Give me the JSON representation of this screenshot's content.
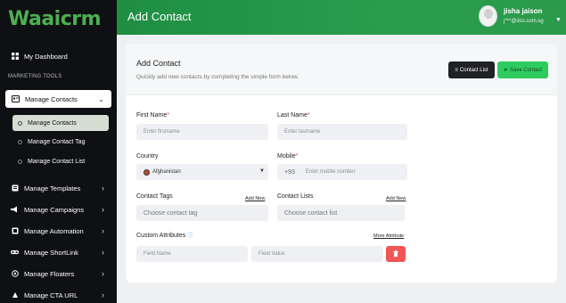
{
  "sidebar": {
    "logo": "Waaicrm",
    "dashboard": "My Dashboard",
    "section": "MARKETING TOOLS",
    "group": "Manage Contacts",
    "sub_items": [
      "Manage Contacts",
      "Manage Contact Tag",
      "Manage Contact List"
    ],
    "items": [
      {
        "label": "Manage Templates",
        "icon": "template-icon"
      },
      {
        "label": "Manage Campaigns",
        "icon": "megaphone-icon"
      },
      {
        "label": "Manage Automation",
        "icon": "automation-icon"
      },
      {
        "label": "Manage ShortLink",
        "icon": "link-icon"
      },
      {
        "label": "Manage Floaters",
        "icon": "whatsapp-icon"
      },
      {
        "label": "Manage CTA URL",
        "icon": "cta-icon"
      }
    ]
  },
  "header": {
    "title": "Add Contact",
    "user_name": "jisha jaison",
    "user_email": "j***@dss.com.sg"
  },
  "card": {
    "title": "Add Contact",
    "subtitle": "Quickly add new contacts by completing the simple form below.",
    "contact_list_button": "Contact List",
    "save_button": "Save Contact"
  },
  "form": {
    "first_name_label": "First Name",
    "first_name_placeholder": "Enter firstname",
    "last_name_label": "Last Name",
    "last_name_placeholder": "Enter lastname",
    "country_label": "Country",
    "country_value": "Afghanistan",
    "mobile_label": "Mobile",
    "mobile_code": "+93",
    "mobile_placeholder": "Enter mobile number",
    "tags_label": "Contact Tags",
    "tags_add": "Add New",
    "tags_placeholder": "Choose contact tag",
    "lists_label": "Contact Lists",
    "lists_add": "Add New",
    "lists_placeholder": "Choose contact list",
    "attributes_label": "Custom Attributes",
    "more_attribute": "More Attribute",
    "field_name_placeholder": "Field Name",
    "field_value_placeholder": "Field Value"
  },
  "colors": {
    "header_green": "#1f8e43",
    "save_green": "#2ecc5f",
    "delete_red": "#f25757",
    "sidebar_bg": "#0f1013"
  }
}
